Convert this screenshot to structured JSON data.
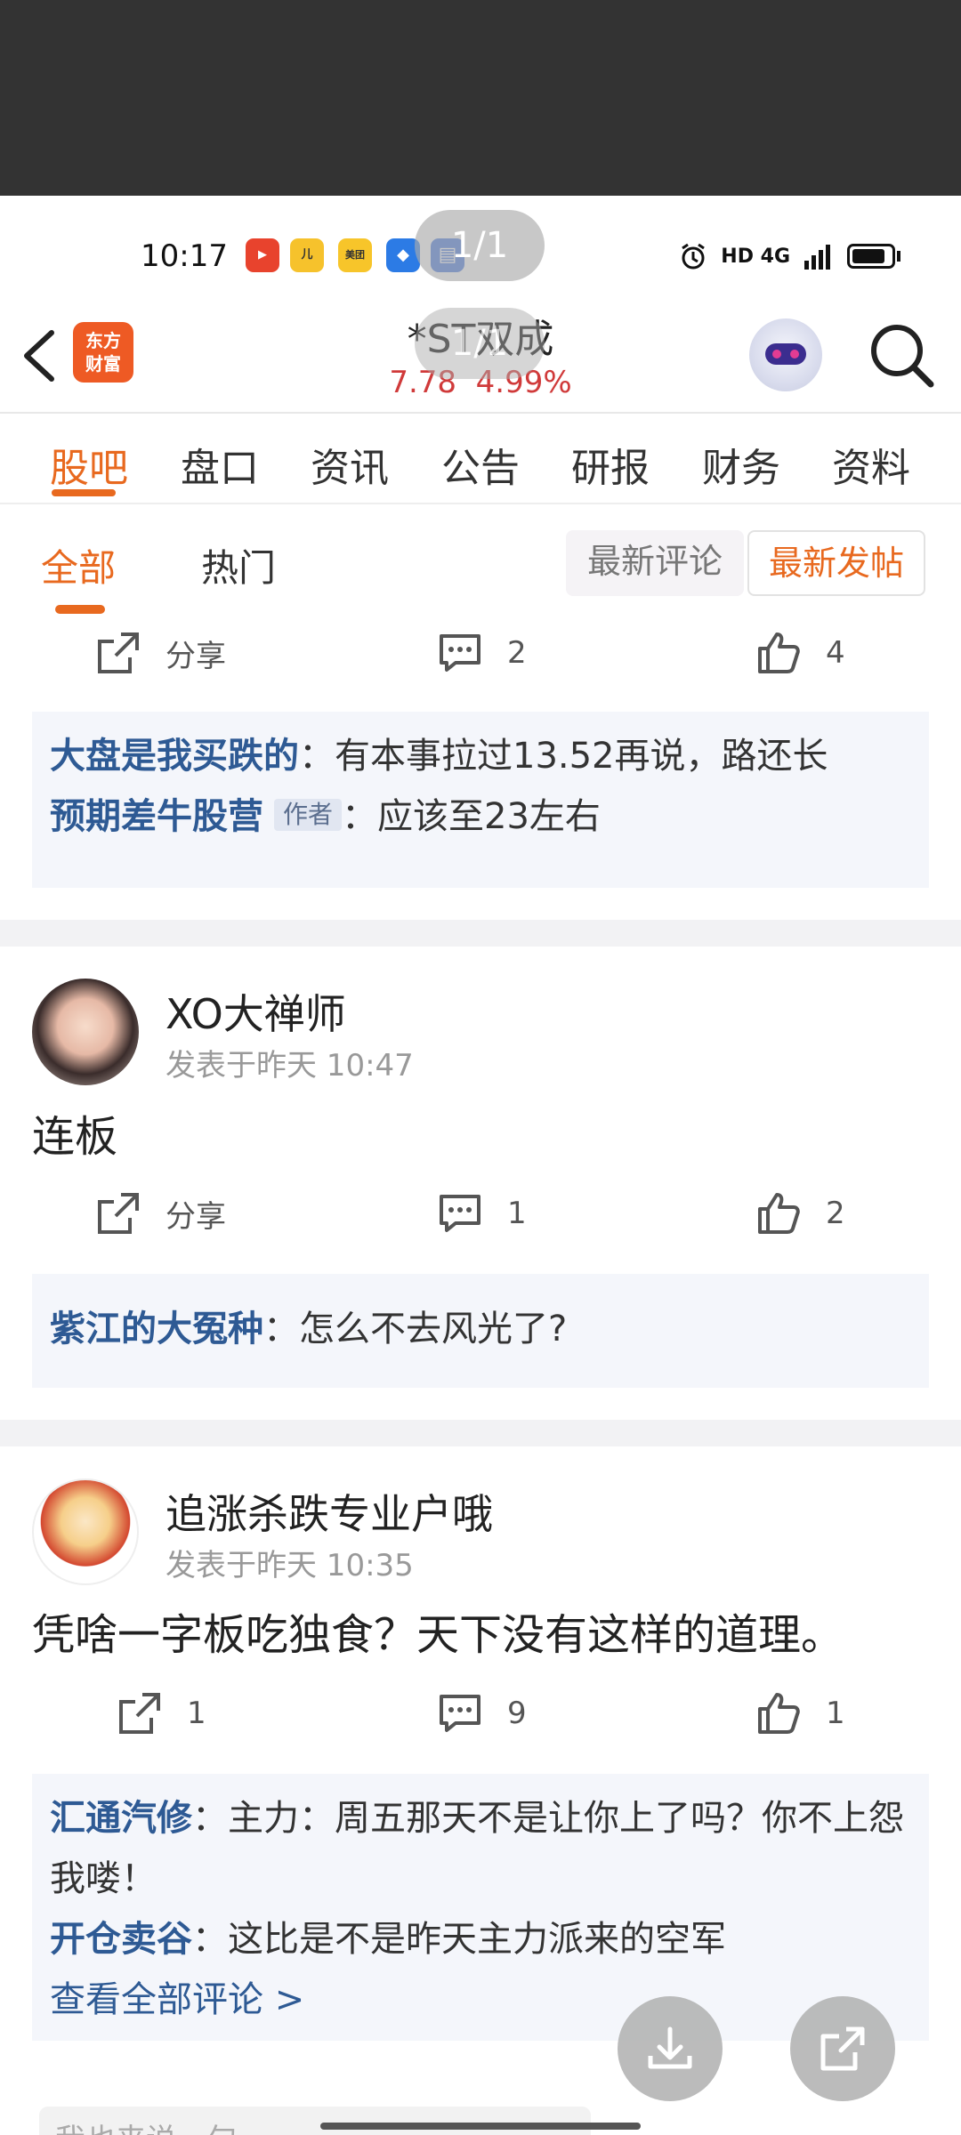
{
  "status_bar": {
    "time": "10:17",
    "app_icons": [
      {
        "name": "video-app-icon",
        "text": "▶",
        "color": "#e8432d"
      },
      {
        "name": "kids-app-icon",
        "text": "儿",
        "color": "#f6c22c"
      },
      {
        "name": "meituan-app-icon",
        "text": "美团",
        "color": "#f7c52a"
      },
      {
        "name": "feather-app-icon",
        "text": "◆",
        "color": "#2c7be5"
      },
      {
        "name": "doc-app-icon",
        "text": "▤",
        "color": "#3a6fe0"
      }
    ],
    "indicators": "HD  4G"
  },
  "page_indicator": "1/1",
  "header": {
    "logo_line1": "东方",
    "logo_line2": "财富",
    "stock_name": "*ST双成",
    "stock_price": "7.78",
    "stock_change": "4.99%"
  },
  "tabs": [
    {
      "label": "股吧",
      "active": true
    },
    {
      "label": "盘口",
      "active": false
    },
    {
      "label": "资讯",
      "active": false
    },
    {
      "label": "公告",
      "active": false
    },
    {
      "label": "研报",
      "active": false
    },
    {
      "label": "财务",
      "active": false
    },
    {
      "label": "资料",
      "active": false
    }
  ],
  "subtabs": {
    "all": "全部",
    "hot": "热门",
    "sort_latest_comment": "最新评论",
    "sort_latest_post": "最新发帖"
  },
  "posts": [
    {
      "share_label": "分享",
      "comments": "2",
      "likes": "4",
      "replies": [
        {
          "user": "大盘是我买跌的",
          "text": "：有本事拉过13.52再说，路还长"
        },
        {
          "user": "预期差牛股营",
          "badge": "作者",
          "text": "：应该至23左右"
        }
      ]
    },
    {
      "username": "XO大禅师",
      "time": "发表于昨天 10:47",
      "content": "连板",
      "share_label": "分享",
      "comments": "1",
      "likes": "2",
      "replies": [
        {
          "user": "紫江的大冤种",
          "text": "：怎么不去风光了?"
        }
      ]
    },
    {
      "username": "追涨杀跌专业户哦",
      "time": "发表于昨天 10:35",
      "content": "凭啥一字板吃独食？天下没有这样的道理。",
      "shares": "1",
      "comments": "9",
      "likes": "1",
      "replies": [
        {
          "user": "汇通汽修",
          "text": "：主力：周五那天不是让你上了吗？你不上怨我喽！"
        },
        {
          "user": "开仓卖谷",
          "text": "：这比是不是昨天主力派来的空军"
        }
      ],
      "view_all": "查看全部评论 >"
    }
  ],
  "input_placeholder": "我也来说一句"
}
